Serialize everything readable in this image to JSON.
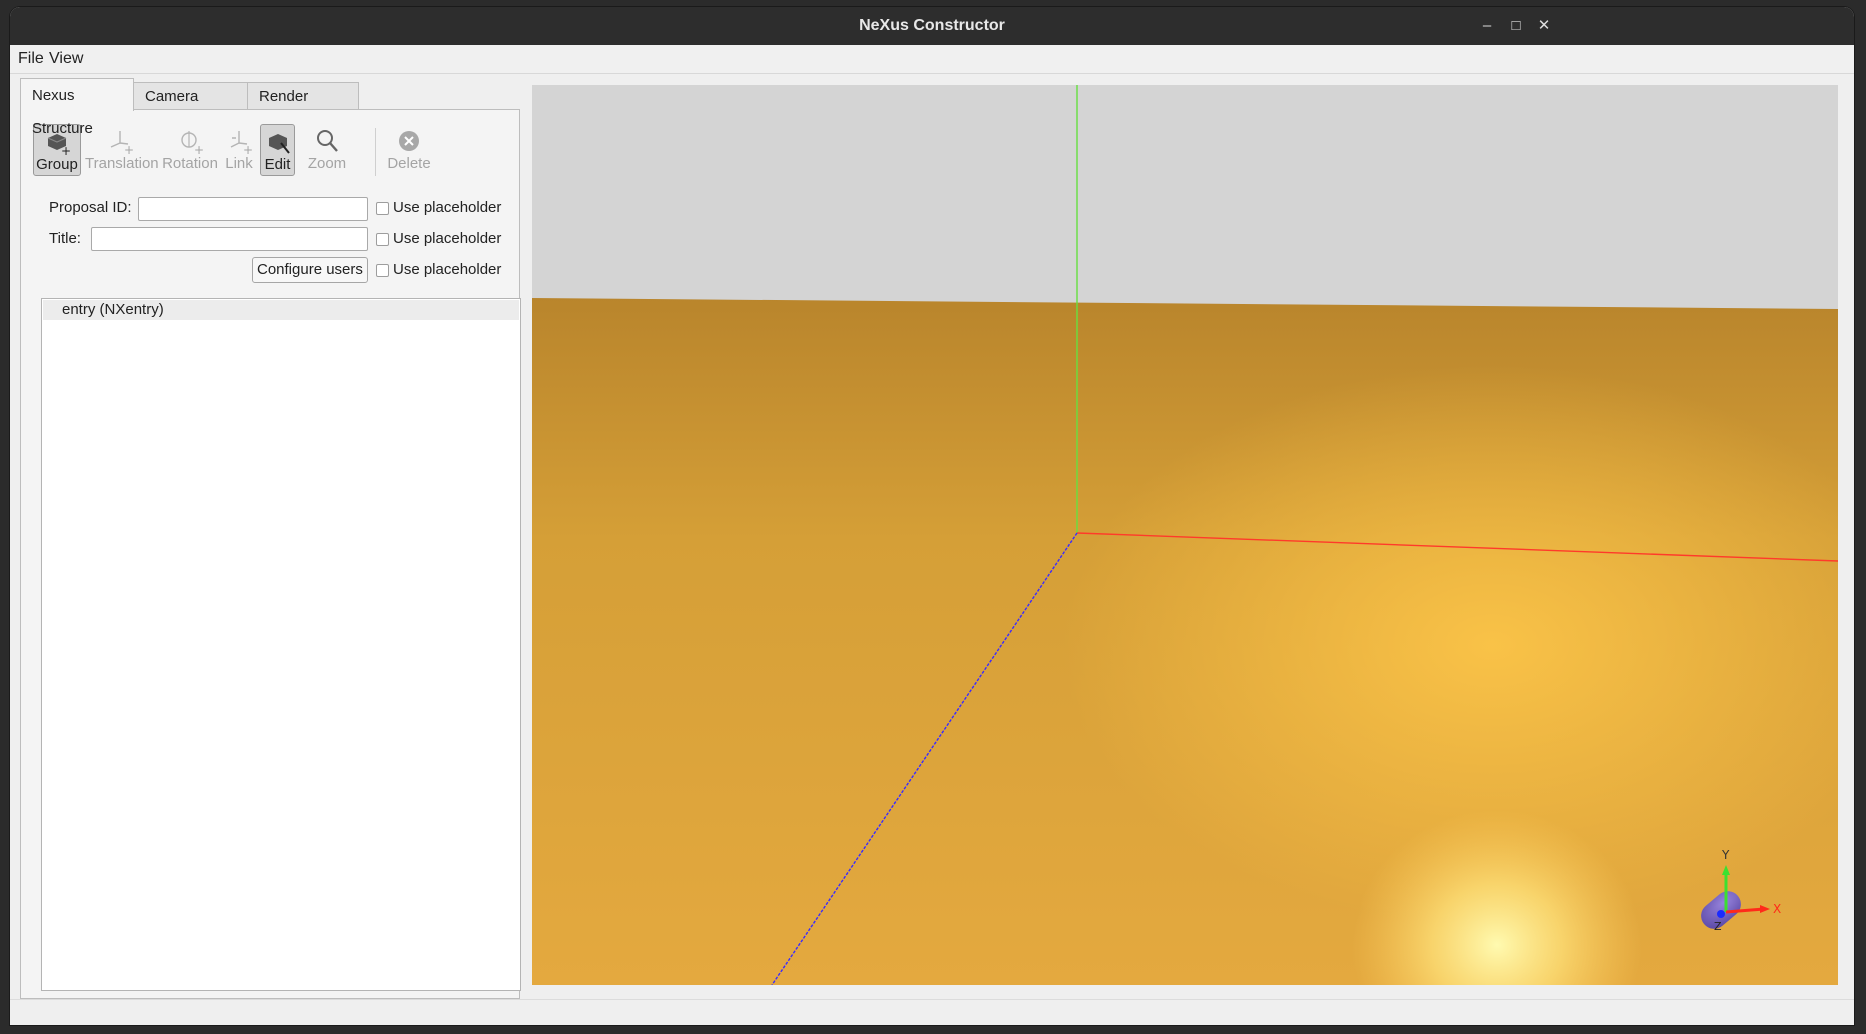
{
  "window": {
    "title": "NeXus Constructor",
    "minimize_glyph": "–",
    "maximize_glyph": "□",
    "close_glyph": "✕"
  },
  "menu": [
    "File",
    "View"
  ],
  "tabs": [
    "Nexus Structure",
    "Camera Settings",
    "Render Settings"
  ],
  "toolbar": [
    {
      "label": "Group",
      "icon": "group-add-icon",
      "state": "pressed"
    },
    {
      "label": "Translation",
      "icon": "translation-icon",
      "state": "disabled"
    },
    {
      "label": "Rotation",
      "icon": "rotation-icon",
      "state": "disabled"
    },
    {
      "label": "Link",
      "icon": "link-icon",
      "state": "disabled"
    },
    {
      "label": "Edit",
      "icon": "edit-icon",
      "state": "pressed"
    },
    {
      "label": "Zoom",
      "icon": "zoom-icon",
      "state": "disabled"
    },
    {
      "label": "Delete",
      "icon": "delete-icon",
      "state": "disabled"
    }
  ],
  "form": {
    "proposal_label": "Proposal ID:",
    "title_label": "Title:",
    "configure_users": "Configure users",
    "placeholder_label": "Use placeholder"
  },
  "tree": {
    "root": "entry (NXentry)"
  },
  "gizmo": {
    "y": "Y",
    "x": "X",
    "z": "Z"
  },
  "colors": {
    "floor": "#e3a636",
    "sky": "#d4d4d4",
    "x_axis": "#ff3a2a",
    "y_axis": "#4fe03a",
    "z_axis": "#3a2aff"
  }
}
